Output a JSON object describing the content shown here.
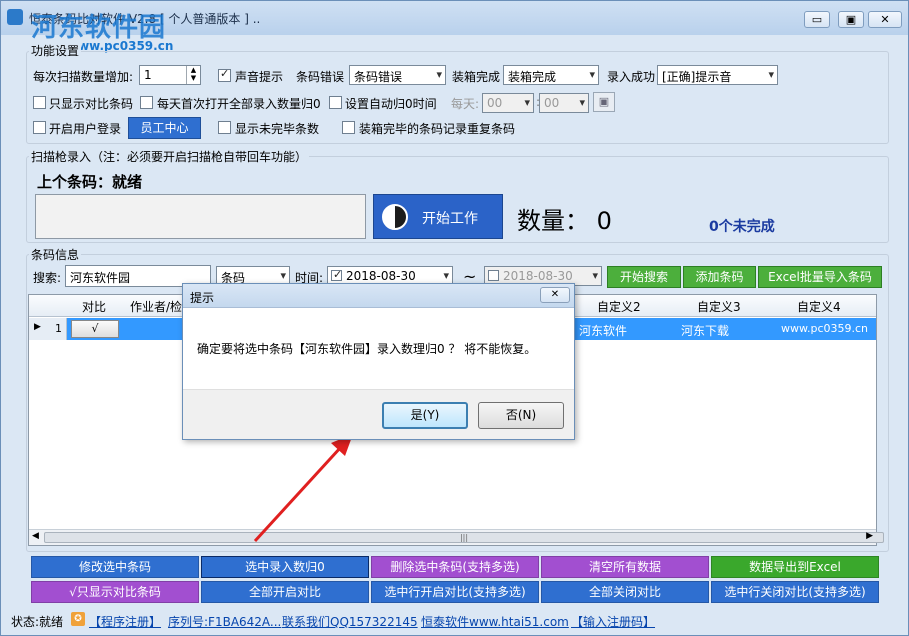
{
  "titlebar": {
    "title": "恒泰条码比对软件 V2.8 [ 个人普通版本 ] ..",
    "watermark": "河东软件园",
    "watermark_url": "www.pc0359.cn",
    "min": "▭",
    "max": "▣",
    "close": "✕"
  },
  "settings": {
    "group_title": "功能设置",
    "scan_inc_label": "每次扫描数量增加:",
    "scan_inc_value": "1",
    "sound_label": "声音提示",
    "sound_checked": true,
    "barcode_error_label": "条码错误",
    "barcode_error_value": "条码错误",
    "pack_done_label": "装箱完成",
    "pack_done_value": "装箱完成",
    "entry_ok_label": "录入成功",
    "entry_ok_value": "[正确]提示音",
    "only_compare_label": "只显示对比条码",
    "daily_reset_label": "每天首次打开全部录入数量归0",
    "auto_reset_label": "设置自动归0时间",
    "daily_label": "每天:",
    "hour_value": "00",
    "minute_value": "00",
    "user_login_label": "开启用户登录",
    "staff_center_label": "员工中心",
    "show_unfinished_label": "显示未完毕条数",
    "dup_record_label": "装箱完毕的条码记录重复条码"
  },
  "scan": {
    "group_title": "扫描枪录入（注：必须要开启扫描枪自带回车功能）",
    "last_code_label": "上个条码：就绪",
    "start_button": "开始工作",
    "count_label": "数量： 0",
    "unfinished_label": "0个未完成"
  },
  "barcode_info": {
    "group_title": "条码信息",
    "search_label": "搜索:",
    "search_value": "河东软件园",
    "field_select": "条码",
    "time_label": "时间:",
    "date_from": "2018-08-30",
    "tilde": "~",
    "date_to": "2018-08-30",
    "start_search": "开始搜索",
    "add_barcode": "添加条码",
    "excel_import": "Excel批量导入条码"
  },
  "grid": {
    "headers": [
      "对比",
      "作业者/检",
      "自定义2",
      "自定义3",
      "自定义4"
    ],
    "row": {
      "index": "1",
      "compare_btn": "√",
      "custom2": "河东软件",
      "custom3": "河东下载",
      "custom4": "www.pc0359.cn"
    },
    "scroll_mark": "|||"
  },
  "actions_row1": {
    "modify": "修改选中条码",
    "reset_selected": "选中录入数归0",
    "delete_selected": "删除选中条码(支持多选)",
    "clear_all": "清空所有数据",
    "export_excel": "数据导出到Excel"
  },
  "actions_row2": {
    "only_compare": "√只显示对比条码",
    "open_all": "全部开启对比",
    "open_selected": "选中行开启对比(支持多选)",
    "close_all": "全部关闭对比",
    "close_selected": "选中行关闭对比(支持多选)"
  },
  "status": {
    "state": "状态:就绪",
    "register": "【程序注册】",
    "serial": "序列号:F1BA642A...",
    "contact": "联系我们QQ157322145",
    "site": "恒泰软件www.htai51.com",
    "input_code": "【输入注册码】"
  },
  "dialog": {
    "title": "提示",
    "close": "✕",
    "message": "确定要将选中条码【河东软件园】录入数理归0 ？ 将不能恢复。",
    "yes": "是(Y)",
    "no": "否(N)"
  },
  "colors": {
    "accent_blue": "#2f6fd0",
    "green": "#4caf3c",
    "purple": "#a24fd0",
    "row_select": "#3399ff",
    "arrow_red": "#e02020"
  }
}
